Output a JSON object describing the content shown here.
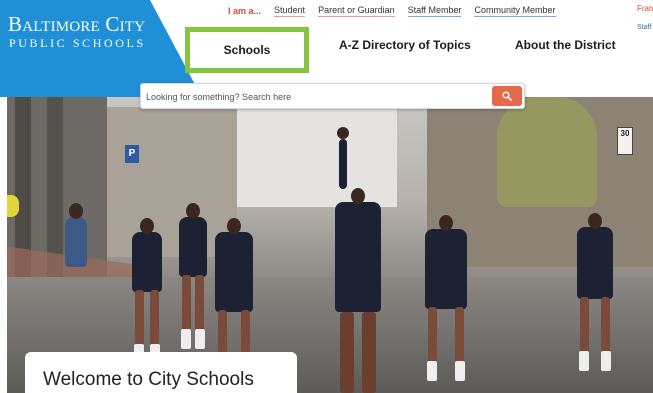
{
  "logo": {
    "line1": "Baltimore City",
    "line2": "PUBLIC SCHOOLS"
  },
  "audience": {
    "prompt": "I am a...",
    "links": [
      "Student",
      "Parent or Guardian",
      "Staff Member",
      "Community Member"
    ]
  },
  "corner": {
    "top": "Fran",
    "staff": "Staff"
  },
  "nav": {
    "items": [
      "Schools",
      "A-Z Directory of Topics",
      "About the District"
    ],
    "highlight_color": "#84c441"
  },
  "search": {
    "placeholder": "Looking for something? Search here",
    "button_icon": "search-icon",
    "button_color": "#e8694a"
  },
  "hero": {
    "image": "marching-band-parade-photo",
    "sign_p": "P",
    "sign_30": "30"
  },
  "welcome": {
    "heading": "Welcome to City Schools"
  },
  "colors": {
    "brand_blue": "#1f8fd6",
    "accent_red": "#d04a3a"
  }
}
